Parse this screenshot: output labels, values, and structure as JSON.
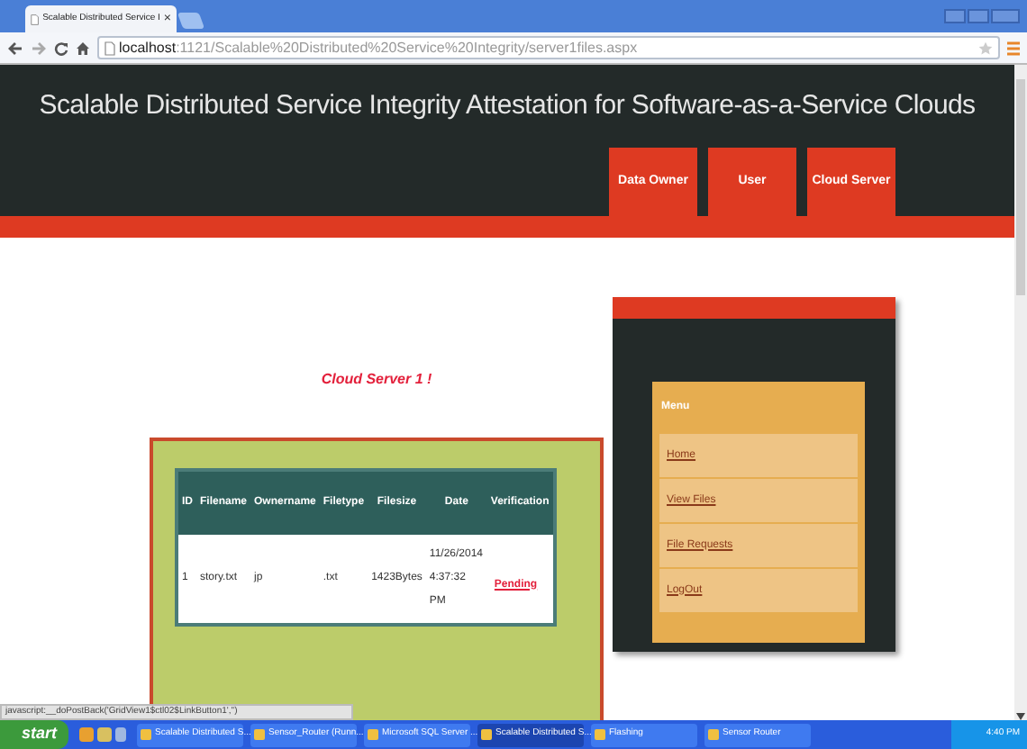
{
  "browser": {
    "tab_title": "Scalable Distributed Service I",
    "tab_close": "×",
    "url_host": "localhost",
    "url_path": ":1121/Scalable%20Distributed%20Service%20Integrity/server1files.aspx"
  },
  "header": {
    "title": "Scalable Distributed Service Integrity Attestation for Software-as-a-Service Clouds",
    "nav": [
      {
        "label": "Data Owner"
      },
      {
        "label": "User"
      },
      {
        "label": "Cloud Server"
      }
    ]
  },
  "page_heading": "Cloud Server 1 !",
  "table": {
    "columns": [
      "ID",
      "Filename",
      "Ownername",
      "Filetype",
      "Filesize",
      "Date",
      "Verification"
    ],
    "rows": [
      {
        "cells": [
          "1",
          "story.txt",
          "jp",
          ".txt",
          "1423Bytes",
          "11/26/2014 4:37:32 PM"
        ],
        "verification": "Pending"
      }
    ]
  },
  "menu": {
    "title": "Menu",
    "items": [
      "Home",
      "View Files",
      "File Requests",
      "LogOut"
    ]
  },
  "status_text": "javascript:__doPostBack('GridView1$ctl02$LinkButton1','')",
  "taskbar": {
    "start": "start",
    "tasks": [
      {
        "label": "Scalable Distributed S...",
        "selected": false
      },
      {
        "label": "Sensor_Router (Runn...",
        "selected": false
      },
      {
        "label": "Microsoft SQL Server ...",
        "selected": false
      },
      {
        "label": "Scalable Distributed S...",
        "selected": true
      },
      {
        "label": "Flashing",
        "selected": false
      },
      {
        "label": "Sensor Router",
        "selected": false
      }
    ],
    "clock": "4:40 PM"
  }
}
